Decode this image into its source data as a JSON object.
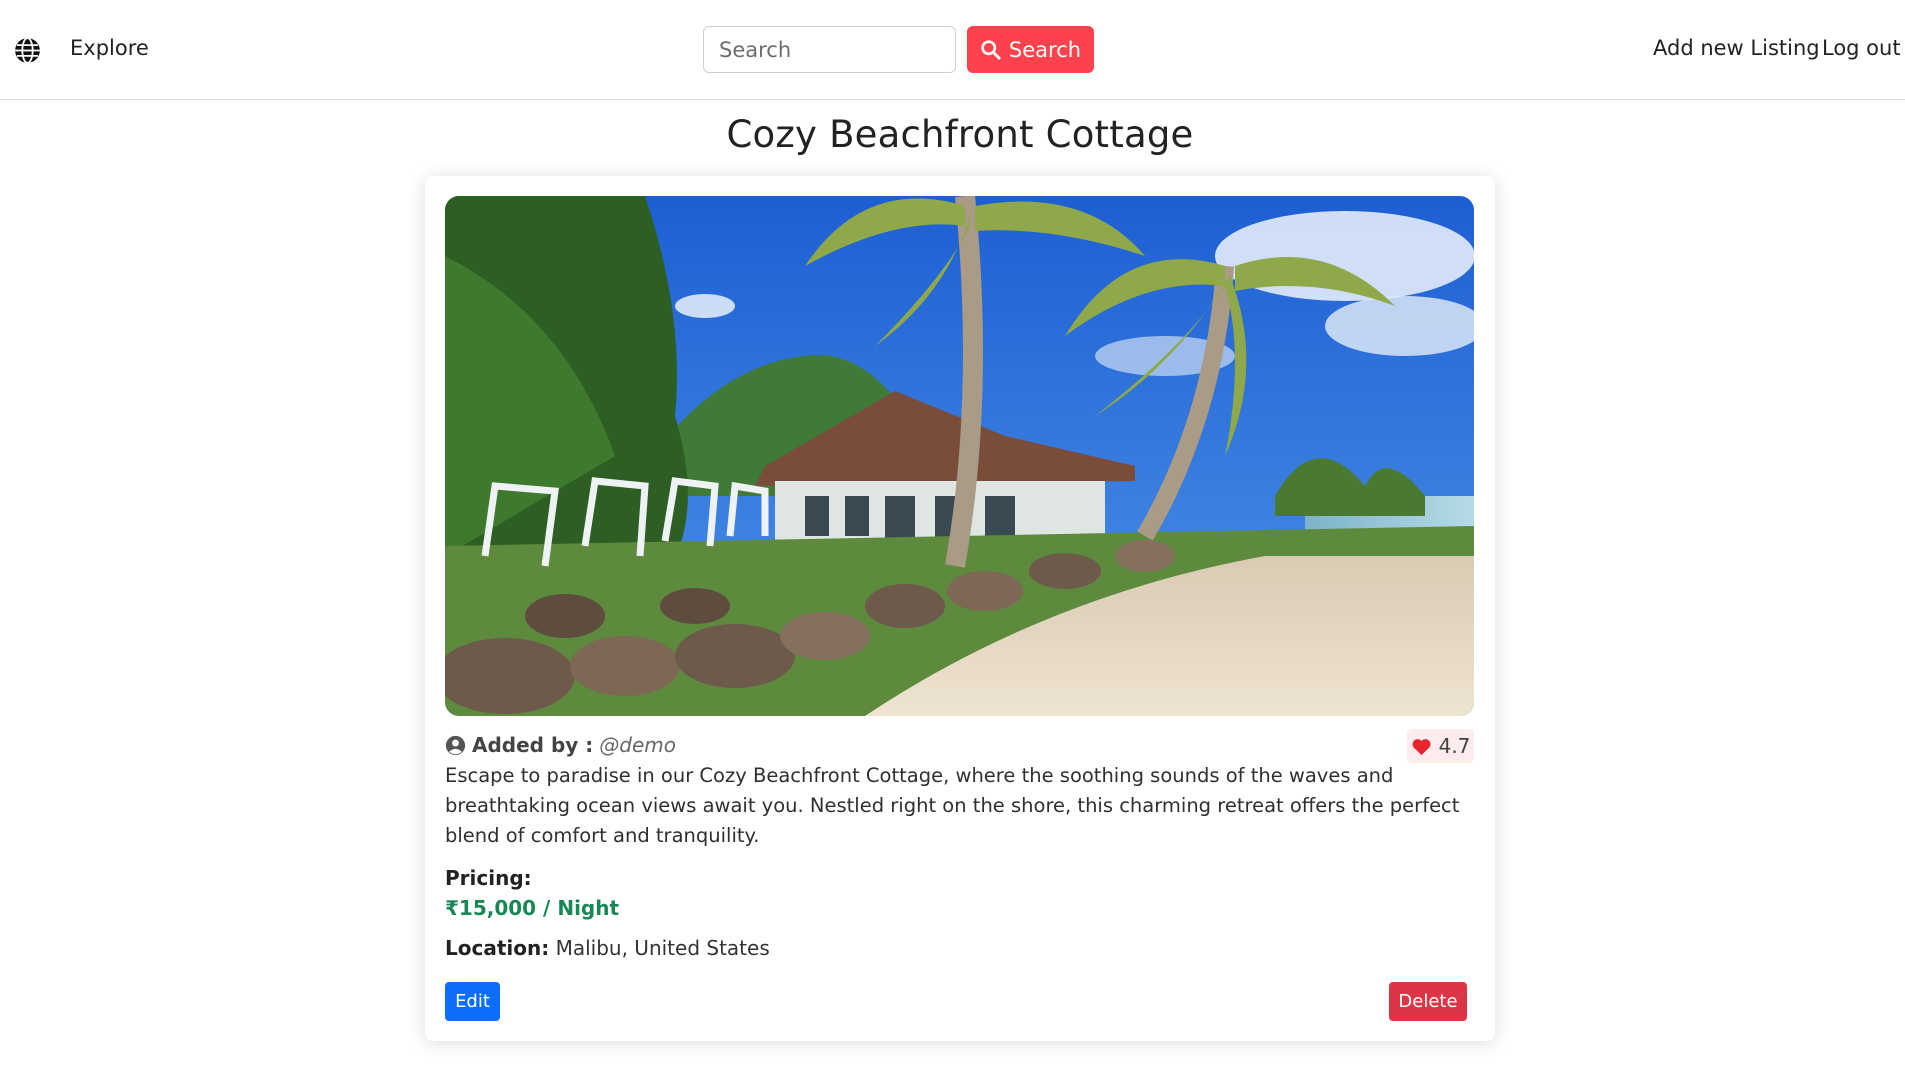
{
  "navbar": {
    "brand_icon": "globe-icon",
    "explore_label": "Explore",
    "search_placeholder": "Search",
    "search_button_label": "Search",
    "search_button_icon": "magnifier-icon",
    "add_listing_label": "Add new Listing",
    "logout_label": "Log out"
  },
  "listing": {
    "title": "Cozy Beachfront Cottage",
    "owner_icon": "user-circle-icon",
    "owner_label": "Added by :",
    "owner_handle": "@demo",
    "rating_icon": "heart-icon",
    "rating": "4.7",
    "description": "Escape to paradise in our Cozy Beachfront Cottage, where the soothing sounds of the waves and breathtaking ocean views await you. Nestled right on the shore, this charming retreat offers the perfect blend of comfort and tranquility.",
    "pricing_label": "Pricing:",
    "price": "₹15,000 / Night",
    "location_label": "Location:",
    "location": "Malibu, United States",
    "edit_label": "Edit",
    "delete_label": "Delete"
  },
  "colors": {
    "brand_red": "#fe424d",
    "price_green": "#198754",
    "edit_blue": "#0d6efd",
    "delete_red": "#dc3545",
    "rating_bg": "#fdecec"
  }
}
